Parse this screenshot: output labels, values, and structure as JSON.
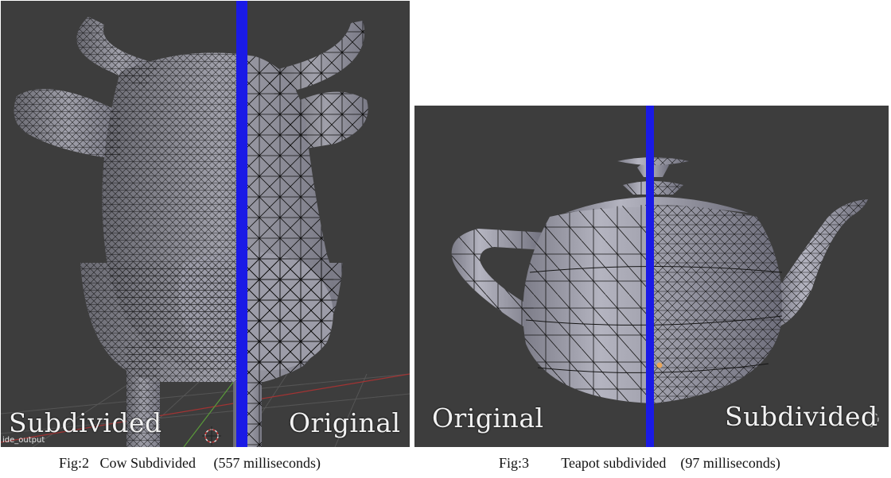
{
  "figures": [
    {
      "id": "fig2",
      "left_label": "Subdivided",
      "right_label": "Original",
      "object_name": "ide_output",
      "caption_number": "Fig:2",
      "caption_title": "Cow Subdivided",
      "caption_time": "(557 milliseconds)",
      "divider_color": "#1a1ae6"
    },
    {
      "id": "fig3",
      "left_label": "Original",
      "right_label": "Subdivided",
      "caption_number": "Fig:3",
      "caption_title": "Teapot subdivided",
      "caption_time": "(97 milliseconds)",
      "divider_color": "#1a1ae6"
    }
  ],
  "colors": {
    "viewport_background": "#3d3d3d",
    "mesh_fill": "#8f8f99",
    "mesh_wire": "#111111",
    "grid_line": "#555555",
    "axis_red": "#a33333",
    "axis_green": "#5a9a3a"
  }
}
